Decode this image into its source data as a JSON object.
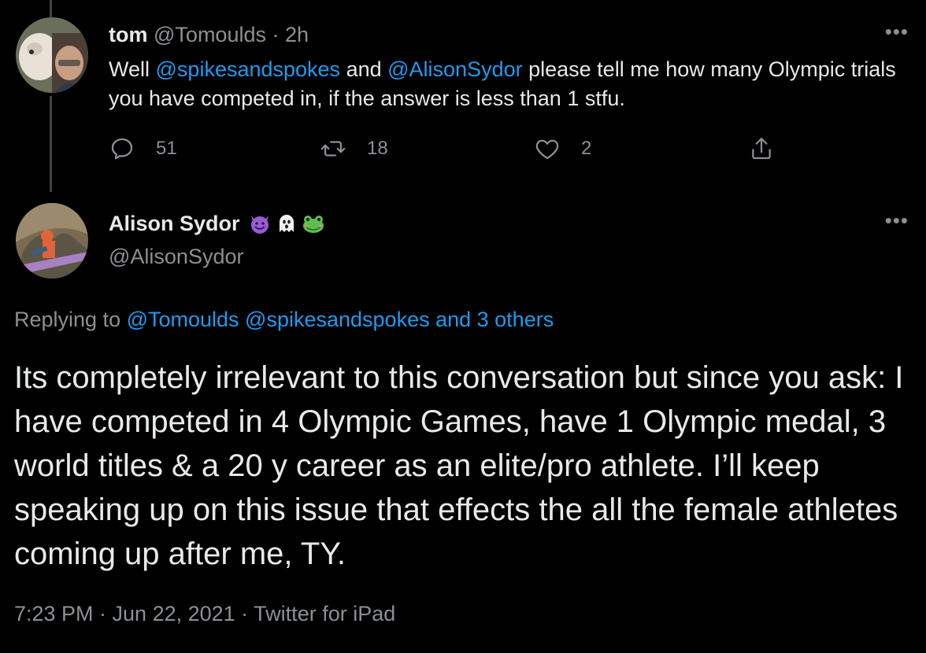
{
  "parent_tweet": {
    "author_name": "tom",
    "author_handle": "@Tomoulds",
    "separator": "·",
    "time_ago": "2h",
    "body": {
      "t1": "Well ",
      "m1": "@spikesandspokes",
      "t2": " and ",
      "m2": "@AlisonSydor",
      "t3": " please tell me how many Olympic trials you have competed in, if the answer is less than 1 stfu."
    },
    "more_label": "•••",
    "actions": {
      "reply_count": "51",
      "retweet_count": "18",
      "like_count": "2"
    }
  },
  "main_tweet": {
    "author_name": "Alison Sydor",
    "author_handle": "@AlisonSydor",
    "more_label": "•••",
    "emojis": [
      "smiling-devil-icon",
      "ghost-icon",
      "frog-icon"
    ],
    "replying_to": {
      "prefix": "Replying to ",
      "users": "@Tomoulds @spikesandspokes and 3 others"
    },
    "text": "Its completely irrelevant to this conversation but since you ask: I have competed in 4 Olympic Games, have 1 Olympic medal, 3 world titles & a 20 y career as an elite/pro athlete. I’ll keep speaking up on this issue that effects the all the female athletes coming up after me, TY.",
    "meta": "7:23 PM · Jun 22, 2021 · Twitter for iPad"
  },
  "colors": {
    "background": "#000000",
    "text": "#e7e9ea",
    "muted": "#8b9096",
    "link": "#1d9bf0",
    "thread_line": "#3d4145"
  }
}
